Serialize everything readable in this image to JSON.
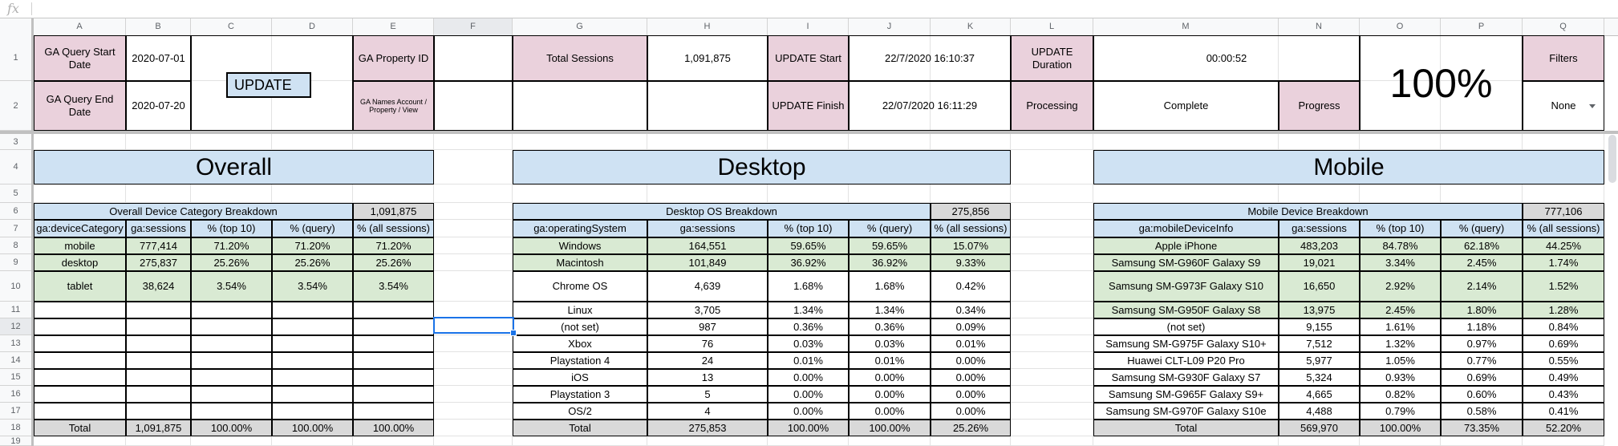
{
  "formula_bar": {
    "icon": "fx",
    "value": ""
  },
  "columns": [
    "A",
    "B",
    "C",
    "D",
    "E",
    "F",
    "G",
    "H",
    "I",
    "J",
    "K",
    "L",
    "M",
    "N",
    "O",
    "P",
    "Q"
  ],
  "rows": [
    "1",
    "2",
    "3",
    "4",
    "5",
    "6",
    "7",
    "8",
    "9",
    "10",
    "11",
    "12",
    "13",
    "14",
    "15",
    "16",
    "17",
    "18",
    "19"
  ],
  "selected_cell": "F12",
  "header": {
    "start_label": "GA Query Start Date",
    "start_value": "2020-07-01",
    "end_label": "GA Query End Date",
    "end_value": "2020-07-20",
    "update_button": "UPDATE",
    "property_label": "GA Property ID",
    "names_label": "GA Names Account / Property / View",
    "total_sessions_label": "Total Sessions",
    "total_sessions_value": "1,091,875",
    "update_start_label": "UPDATE Start",
    "update_start_value": "22/7/2020 16:10:37",
    "update_finish_label": "UPDATE Finish",
    "update_finish_value": "22/07/2020 16:11:29",
    "update_duration_label": "UPDATE Duration",
    "update_duration_value": "00:00:52",
    "processing_label": "Processing",
    "processing_value": "Complete",
    "progress_label": "Progress",
    "progress_value": "100%",
    "filters_label": "Filters",
    "filters_value": "None"
  },
  "sections": {
    "overall": {
      "title": "Overall",
      "table_title": "Overall Device Category Breakdown",
      "table_total": "1,091,875",
      "headers": [
        "ga:deviceCategory",
        "ga:sessions",
        "% (top 10)",
        "% (query)",
        "% (all sessions)"
      ],
      "rows": [
        [
          "mobile",
          "777,414",
          "71.20%",
          "71.20%",
          "71.20%"
        ],
        [
          "desktop",
          "275,837",
          "25.26%",
          "25.26%",
          "25.26%"
        ],
        [
          "tablet",
          "38,624",
          "3.54%",
          "3.54%",
          "3.54%"
        ]
      ],
      "total": [
        "Total",
        "1,091,875",
        "100.00%",
        "100.00%",
        "100.00%"
      ]
    },
    "desktop": {
      "title": "Desktop",
      "table_title": "Desktop OS Breakdown",
      "table_total": "275,856",
      "headers": [
        "ga:operatingSystem",
        "ga:sessions",
        "% (top 10)",
        "% (query)",
        "% (all sessions)"
      ],
      "rows": [
        [
          "Windows",
          "164,551",
          "59.65%",
          "59.65%",
          "15.07%"
        ],
        [
          "Macintosh",
          "101,849",
          "36.92%",
          "36.92%",
          "9.33%"
        ],
        [
          "Chrome OS",
          "4,639",
          "1.68%",
          "1.68%",
          "0.42%"
        ],
        [
          "Linux",
          "3,705",
          "1.34%",
          "1.34%",
          "0.34%"
        ],
        [
          "(not set)",
          "987",
          "0.36%",
          "0.36%",
          "0.09%"
        ],
        [
          "Xbox",
          "76",
          "0.03%",
          "0.03%",
          "0.01%"
        ],
        [
          "Playstation 4",
          "24",
          "0.01%",
          "0.01%",
          "0.00%"
        ],
        [
          "iOS",
          "13",
          "0.00%",
          "0.00%",
          "0.00%"
        ],
        [
          "Playstation 3",
          "5",
          "0.00%",
          "0.00%",
          "0.00%"
        ],
        [
          "OS/2",
          "4",
          "0.00%",
          "0.00%",
          "0.00%"
        ]
      ],
      "total": [
        "Total",
        "275,853",
        "100.00%",
        "100.00%",
        "25.26%"
      ]
    },
    "mobile": {
      "title": "Mobile",
      "table_title": "Mobile Device Breakdown",
      "table_total": "777,106",
      "headers": [
        "ga:mobileDeviceInfo",
        "ga:sessions",
        "% (top 10)",
        "% (query)",
        "% (all sessions)"
      ],
      "rows": [
        [
          "Apple iPhone",
          "483,203",
          "84.78%",
          "62.18%",
          "44.25%"
        ],
        [
          "Samsung SM-G960F Galaxy S9",
          "19,021",
          "3.34%",
          "2.45%",
          "1.74%"
        ],
        [
          "Samsung SM-G973F Galaxy S10",
          "16,650",
          "2.92%",
          "2.14%",
          "1.52%"
        ],
        [
          "Samsung SM-G950F Galaxy S8",
          "13,975",
          "2.45%",
          "1.80%",
          "1.28%"
        ],
        [
          "(not set)",
          "9,155",
          "1.61%",
          "1.18%",
          "0.84%"
        ],
        [
          "Samsung SM-G975F Galaxy S10+",
          "7,512",
          "1.32%",
          "0.97%",
          "0.69%"
        ],
        [
          "Huawei CLT-L09 P20 Pro",
          "5,977",
          "1.05%",
          "0.77%",
          "0.55%"
        ],
        [
          "Samsung SM-G930F Galaxy S7",
          "5,324",
          "0.93%",
          "0.69%",
          "0.49%"
        ],
        [
          "Samsung SM-G965F Galaxy S9+",
          "4,665",
          "0.82%",
          "0.60%",
          "0.43%"
        ],
        [
          "Samsung SM-G970F Galaxy S10e",
          "4,488",
          "0.79%",
          "0.58%",
          "0.41%"
        ]
      ],
      "total": [
        "Total",
        "569,970",
        "100.00%",
        "73.35%",
        "52.20%"
      ]
    }
  },
  "colors": {
    "label_pink": "#ead1dc",
    "header_blue": "#cfe2f3",
    "row_green": "#d9ead3",
    "total_grey": "#d9d9d9",
    "selection_blue": "#1a73e8"
  }
}
